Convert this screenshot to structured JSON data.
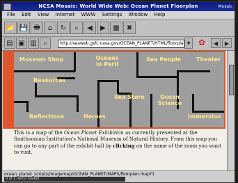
{
  "window": {
    "title": "NCSA Mosaic: World Wide Web: Ocean Planet Floorplan",
    "title_right": "Mosaic"
  },
  "menu": {
    "items": [
      "File",
      "Edit",
      "View",
      "Internet",
      "WWW",
      "Settings",
      "Window",
      "Help"
    ]
  },
  "toolbar": {
    "icons": [
      "open-icon",
      "save-icon",
      "print-icon",
      "home-icon",
      "reload-icon",
      "find-icon",
      "back-icon",
      "forward-icon",
      "load-images-icon",
      "abort-icon"
    ]
  },
  "urlbar": {
    "url": "http://seaweb.gsfc.nasa.gov/OCEAN_PLANET/HTML/floorplan.html"
  },
  "map": {
    "rooms": [
      "Museum Shop",
      "Oceans in Peril",
      "Sea People",
      "Theater",
      "Resources",
      "Sea Store",
      "Ocean Science",
      "Reflections",
      "Heroes",
      "Immersion"
    ]
  },
  "content": {
    "description_prefix": "This is a map of the ",
    "exhibit_name": "Ocean Planet Exhibition",
    "description_mid": " as currently presented at the Smithsonian Institution's National Museum of Natural History. From this map you can go to any part of the exhibit hall by ",
    "click_word": "clicking",
    "description_end": " on the name of the room you want to visit."
  },
  "status": {
    "url_line": "ocean_planet_scripts/imagemap/OCEAN_PLANET/MAPS/floorplan.map?1",
    "progress_text": "0 of 2 items loaded"
  },
  "colors": {
    "map_frame": "#e0552c",
    "room_label": "#ffe98a",
    "titlebar": "#0a1a7a"
  }
}
